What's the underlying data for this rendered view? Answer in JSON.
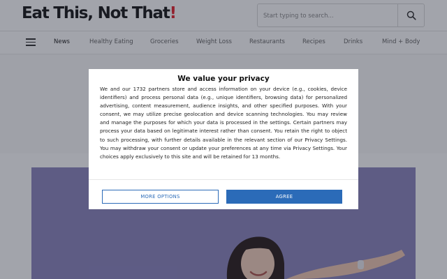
{
  "header": {
    "logo_main": "Eat This, Not That",
    "logo_bang": "!",
    "search_placeholder": "Start typing to search...",
    "search_icon": "magnifier-icon"
  },
  "nav": {
    "menu_icon": "hamburger-icon",
    "items": [
      {
        "label": "News",
        "active": true
      },
      {
        "label": "Healthy Eating",
        "active": false
      },
      {
        "label": "Groceries",
        "active": false
      },
      {
        "label": "Weight Loss",
        "active": false
      },
      {
        "label": "Restaurants",
        "active": false
      },
      {
        "label": "Recipes",
        "active": false
      },
      {
        "label": "Drinks",
        "active": false
      },
      {
        "label": "Mind + Body",
        "active": false
      }
    ]
  },
  "consent": {
    "title": "We value your privacy",
    "body": "We and our 1732 partners store and access information on your device (e.g., cookies, device identifiers) and process personal data (e.g., unique identifiers, browsing data) for personalized advertising, content measurement, audience insights, and other specified purposes. With your consent, we may utilize precise geolocation and device scanning technologies. You may review and manage the purposes for which your data is processed in the settings. Certain partners may process your data based on legitimate interest rather than consent. You retain the right to object to such processing, with further details available in the relevant section of our Privacy Settings. You may withdraw your consent or update your preferences at any time via Privacy Settings. Your choices apply exclusively to this site and will be retained for 13 months.",
    "more_options_label": "MORE OPTIONS",
    "agree_label": "AGREE"
  },
  "colors": {
    "brand_red": "#e4262f",
    "button_blue": "#2b6bb8",
    "hero_bg": "#8e87bf"
  }
}
